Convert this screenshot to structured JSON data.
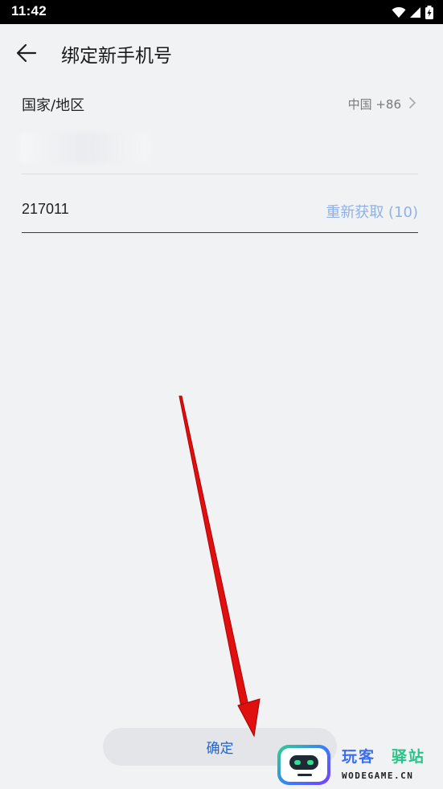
{
  "status_bar": {
    "time": "11:42",
    "icons": [
      "wifi-icon",
      "signal-icon",
      "battery-charging-icon"
    ]
  },
  "header": {
    "back_icon": "arrow-left-icon",
    "title": "绑定新手机号"
  },
  "form": {
    "region_label": "国家/地区",
    "region_value": "中国 +86",
    "region_icon": "chevron-right-icon",
    "phone_value": "",
    "code_value": "217011",
    "resend_label": "重新获取 (10)"
  },
  "footer": {
    "confirm_label": "确定"
  },
  "watermark": {
    "cn_part1": "玩客",
    "cn_part2": "驿站",
    "en": "WODEGAME.CN"
  },
  "colors": {
    "background": "#f1f2f4",
    "accent": "#1e63d6",
    "resend_disabled": "#8fb1e8",
    "annotation_arrow": "#e01010"
  }
}
